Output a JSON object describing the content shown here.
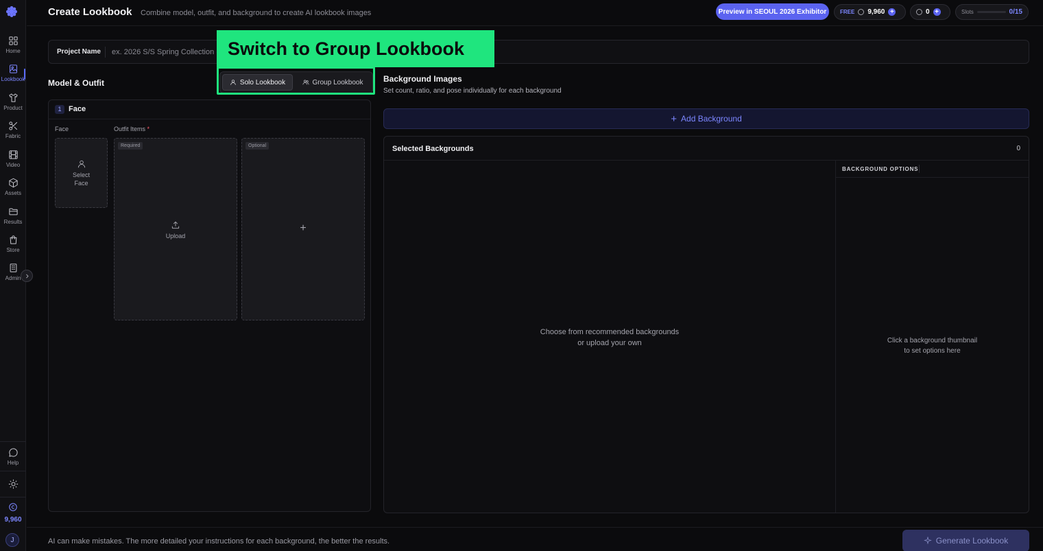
{
  "sidebar": {
    "items": [
      {
        "label": "Home",
        "icon": "grid-icon"
      },
      {
        "label": "Lookbook",
        "icon": "image-book-icon",
        "active": true
      },
      {
        "label": "Product",
        "icon": "shirt-icon"
      },
      {
        "label": "Fabric",
        "icon": "scissors-icon"
      },
      {
        "label": "Video",
        "icon": "film-icon"
      },
      {
        "label": "Assets",
        "icon": "cube-icon"
      },
      {
        "label": "Results",
        "icon": "folder-icon"
      },
      {
        "label": "Store",
        "icon": "bag-icon"
      },
      {
        "label": "Admin",
        "icon": "building-icon"
      }
    ],
    "help_label": "Help",
    "credits": "9,960",
    "avatar_initial": "J"
  },
  "header": {
    "title": "Create Lookbook",
    "subtitle": "Combine model, outfit, and background to create AI lookbook images",
    "preview_button": "Preview in SEOUL 2026 Exhibitor",
    "plan_tag": "FREE",
    "plan_credits": "9,960",
    "bonus_credits": "0",
    "slots_label": "Slots",
    "slots_value": "0/15"
  },
  "project": {
    "label": "Project Name",
    "placeholder": "ex. 2026 S/S Spring Collection ("
  },
  "callout": {
    "text": "Switch to Group Lookbook"
  },
  "model_outfit": {
    "title": "Model & Outfit",
    "mode_solo": "Solo Lookbook",
    "mode_group": "Group Lookbook",
    "step_number": "1",
    "card_title": "Face",
    "face_label": "Face",
    "outfit_label": "Outfit Items",
    "required_mark": "*",
    "select_face_line1": "Select",
    "select_face_line2": "Face",
    "required_tag": "Required",
    "upload_label": "Upload",
    "optional_tag": "Optional",
    "optional_plus": "+"
  },
  "background": {
    "title": "Background Images",
    "subtitle": "Set count, ratio, and pose individually for each background",
    "add_button": "Add Background",
    "selected_title": "Selected Backgrounds",
    "selected_count": "0",
    "empty_line1": "Choose from recommended backgrounds",
    "empty_line2": "or upload your own",
    "options_title": "BACKGROUND OPTIONS",
    "options_line1": "Click a background thumbnail",
    "options_line2": "to set options here"
  },
  "footer": {
    "note": "AI can make mistakes. The more detailed your instructions for each background, the better the results.",
    "generate_button": "Generate Lookbook"
  },
  "colors": {
    "accent": "#5b63f0",
    "callout": "#1fe57e",
    "background": "#0b0b0d"
  }
}
